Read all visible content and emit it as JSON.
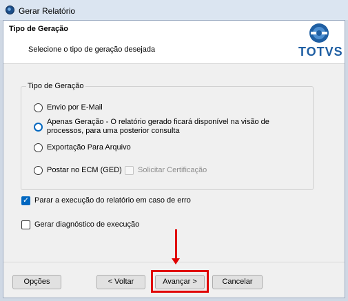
{
  "window": {
    "title": "Gerar Relatório"
  },
  "header": {
    "title": "Tipo de Geração",
    "subtitle": "Selecione o tipo de geração desejada",
    "logo_text": "TOTVS"
  },
  "group": {
    "legend": "Tipo de Geração",
    "options": [
      {
        "label": "Envio por E-Mail",
        "selected": false
      },
      {
        "label_line1": "Apenas Geração - O relatório gerado ficará disponível na visão de",
        "label_line2": "processos, para uma posterior consulta",
        "selected": true
      },
      {
        "label": "Exportação Para Arquivo",
        "selected": false
      },
      {
        "label": "Postar no ECM (GED)",
        "selected": false
      }
    ],
    "certificate_label": "Solicitar Certificação"
  },
  "checks": {
    "stop_on_error": "Parar a execução do relatório em caso de erro",
    "stop_on_error_checked": true,
    "diagnostic": "Gerar diagnóstico de execução",
    "diagnostic_checked": false
  },
  "buttons": {
    "options": "Opções",
    "back": "< Voltar",
    "next": "Avançar >",
    "cancel": "Cancelar"
  },
  "colors": {
    "accent": "#0067c0",
    "annotation": "#e00000",
    "brand": "#1f5fa3"
  }
}
